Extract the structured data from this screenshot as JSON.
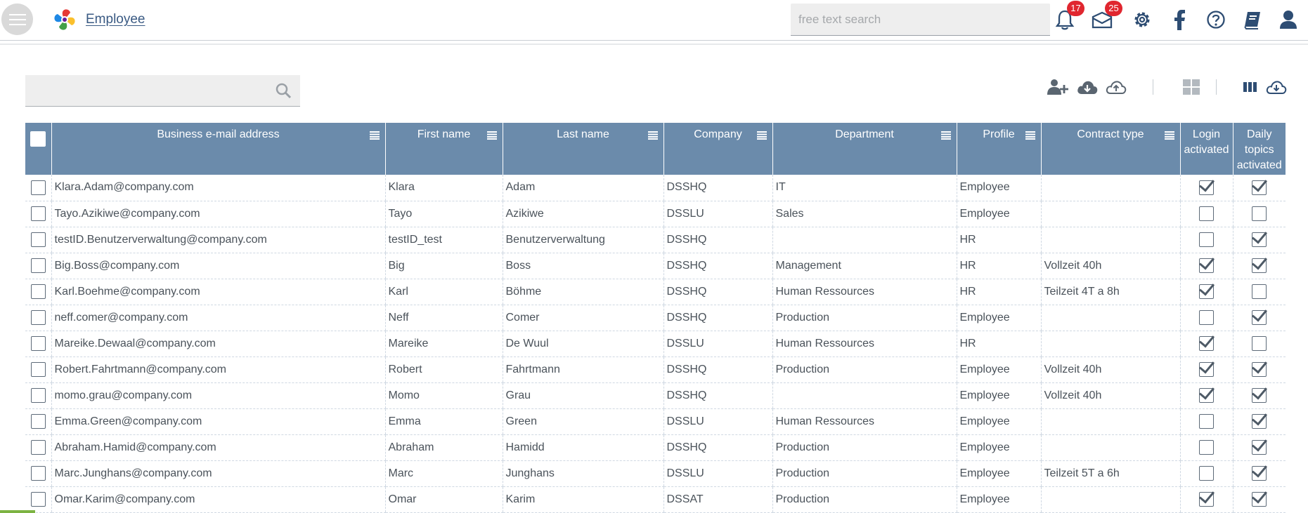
{
  "app": {
    "title": "Employee"
  },
  "header": {
    "search_placeholder": "free text search",
    "notifications_count": "17",
    "messages_count": "25",
    "icons": [
      "menu-icon",
      "bell-icon",
      "mail-icon",
      "gear-icon",
      "facebook-icon",
      "help-icon",
      "book-icon",
      "user-icon"
    ]
  },
  "toolbar": {
    "icons": [
      "add-user-icon",
      "cloud-download-icon",
      "cloud-upload-icon",
      "grid-view-icon",
      "columns-icon",
      "export-download-icon"
    ]
  },
  "colors": {
    "header_bg": "#6b8bab",
    "title": "#3a5a83",
    "badge": "#e0262f",
    "icon": "#2e4d73"
  },
  "table": {
    "columns": [
      "Business e-mail address",
      "First name",
      "Last name",
      "Company",
      "Department",
      "Profile",
      "Contract type",
      "Login activated",
      "Daily topics activated"
    ],
    "rows": [
      {
        "email": "Klara.Adam@company.com",
        "first": "Klara",
        "last": "Adam",
        "company": "DSSHQ",
        "department": "IT",
        "profile": "Employee",
        "contract": "",
        "login": true,
        "daily": true
      },
      {
        "email": "Tayo.Azikiwe@company.com",
        "first": "Tayo",
        "last": "Azikiwe",
        "company": "DSSLU",
        "department": "Sales",
        "profile": "Employee",
        "contract": "",
        "login": false,
        "daily": false
      },
      {
        "email": "testID.Benutzerverwaltung@company.com",
        "first": "testID_test",
        "last": "Benutzerverwaltung",
        "company": "DSSHQ",
        "department": "",
        "profile": "HR",
        "contract": "",
        "login": false,
        "daily": true
      },
      {
        "email": "Big.Boss@company.com",
        "first": "Big",
        "last": "Boss",
        "company": "DSSHQ",
        "department": "Management",
        "profile": "HR",
        "contract": "Vollzeit 40h",
        "login": true,
        "daily": true
      },
      {
        "email": "Karl.Boehme@company.com",
        "first": "Karl",
        "last": "Böhme",
        "company": "DSSHQ",
        "department": "Human Ressources",
        "profile": "HR",
        "contract": "Teilzeit 4T a 8h",
        "login": true,
        "daily": false
      },
      {
        "email": "neff.comer@company.com",
        "first": "Neff",
        "last": "Comer",
        "company": "DSSHQ",
        "department": "Production",
        "profile": "Employee",
        "contract": "",
        "login": false,
        "daily": true
      },
      {
        "email": "Mareike.Dewaal@company.com",
        "first": "Mareike",
        "last": "De Wuul",
        "company": "DSSLU",
        "department": "Human Ressources",
        "profile": "HR",
        "contract": "",
        "login": true,
        "daily": false
      },
      {
        "email": "Robert.Fahrtmann@company.com",
        "first": "Robert",
        "last": "Fahrtmann",
        "company": "DSSHQ",
        "department": "Production",
        "profile": "Employee",
        "contract": "Vollzeit 40h",
        "login": true,
        "daily": true
      },
      {
        "email": "momo.grau@company.com",
        "first": "Momo",
        "last": "Grau",
        "company": "DSSHQ",
        "department": "",
        "profile": "Employee",
        "contract": "Vollzeit 40h",
        "login": true,
        "daily": true
      },
      {
        "email": "Emma.Green@company.com",
        "first": "Emma",
        "last": "Green",
        "company": "DSSLU",
        "department": "Human Ressources",
        "profile": "Employee",
        "contract": "",
        "login": false,
        "daily": true
      },
      {
        "email": "Abraham.Hamid@company.com",
        "first": "Abraham",
        "last": "Hamidd",
        "company": "DSSHQ",
        "department": "Production",
        "profile": "Employee",
        "contract": "",
        "login": false,
        "daily": true
      },
      {
        "email": "Marc.Junghans@company.com",
        "first": "Marc",
        "last": "Junghans",
        "company": "DSSLU",
        "department": "Production",
        "profile": "Employee",
        "contract": "Teilzeit 5T a 6h",
        "login": false,
        "daily": true
      },
      {
        "email": "Omar.Karim@company.com",
        "first": "Omar",
        "last": "Karim",
        "company": "DSSAT",
        "department": "Production",
        "profile": "Employee",
        "contract": "",
        "login": true,
        "daily": true
      }
    ]
  }
}
